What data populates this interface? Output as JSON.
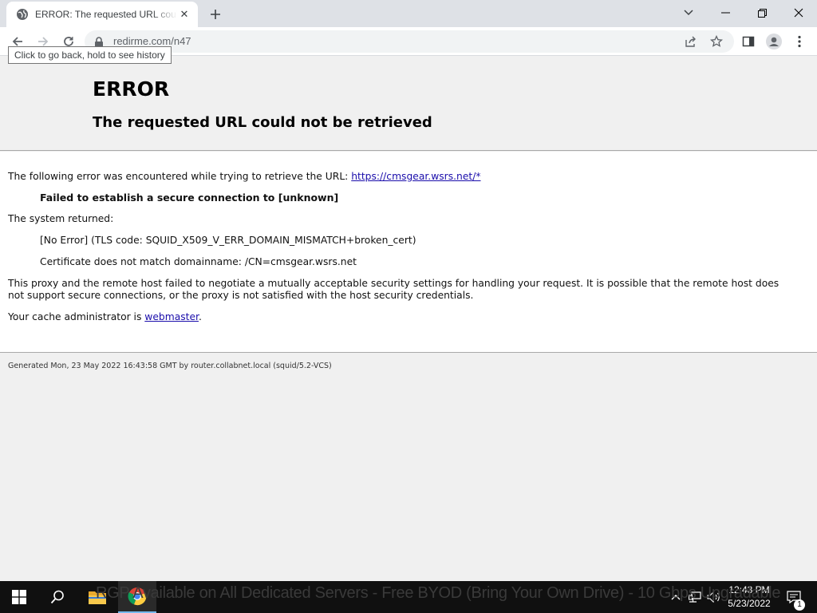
{
  "browser": {
    "tab_title": "ERROR: The requested URL could not be retrieved",
    "url": "redirme.com/n47",
    "back_tooltip": "Click to go back, hold to see history"
  },
  "page": {
    "title": "ERROR",
    "subtitle": "The requested URL could not be retrieved",
    "intro": "The following error was encountered while trying to retrieve the URL: ",
    "intro_link": "https://cmsgear.wsrs.net/*",
    "error_message": "Failed to establish a secure connection to [unknown]",
    "system_returned_label": "The system returned:",
    "system_returned": "[No Error] (TLS code: SQUID_X509_V_ERR_DOMAIN_MISMATCH+broken_cert)",
    "cert_detail": "Certificate does not match domainname: /CN=cmsgear.wsrs.net",
    "explanation": "This proxy and the remote host failed to negotiate a mutually acceptable security settings for handling your request. It is possible that the remote host does not support secure connections, or the proxy is not satisfied with the host security credentials.",
    "admin_prefix": "Your cache administrator is ",
    "admin_link": "webmaster",
    "admin_suffix": ".",
    "footer": "Generated Mon, 23 May 2022 16:43:58 GMT by router.collabnet.local (squid/5.2-VCS)"
  },
  "taskbar": {
    "ticker": "RGP Available on All Dedicated Servers - Free BYOD (Bring Your Own Drive) - 10 Gbps Upgradable",
    "time": "12:43 PM",
    "date": "5/23/2022",
    "notification_count": "1"
  },
  "colors": {
    "link": "#1a0dab",
    "chrome_frame": "#dee1e6",
    "taskbar": "#101010"
  }
}
